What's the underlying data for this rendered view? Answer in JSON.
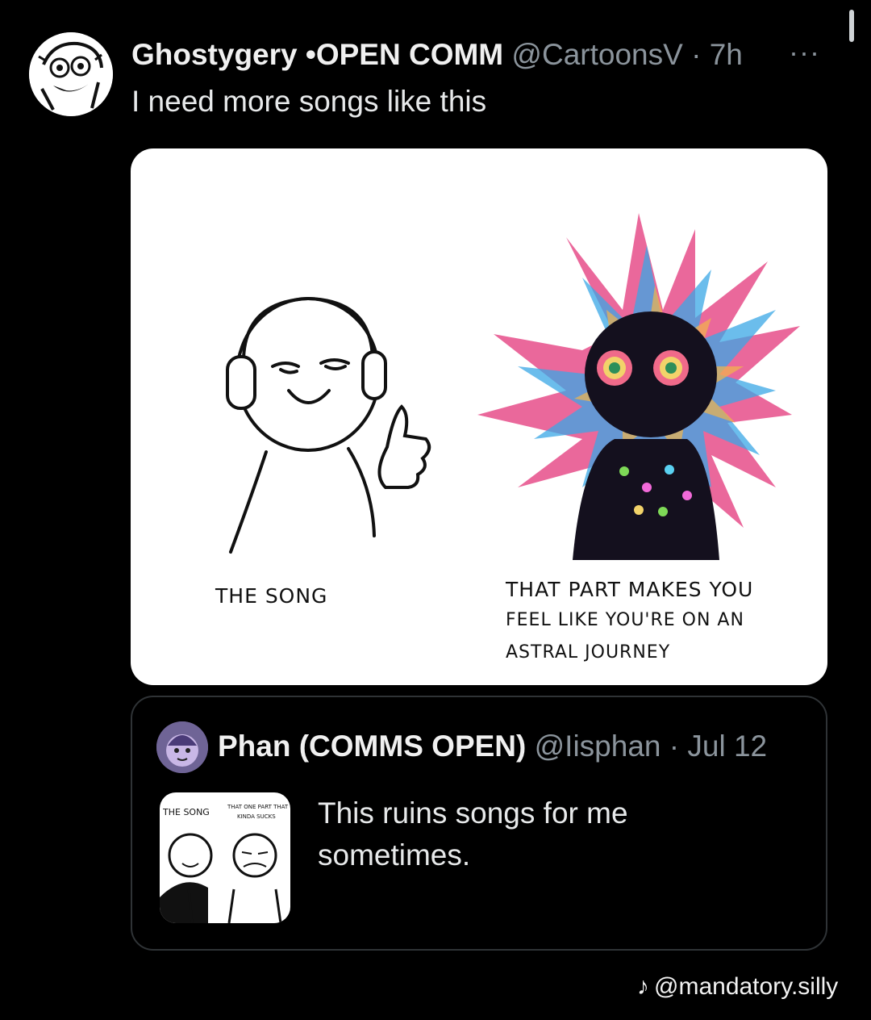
{
  "tweet": {
    "display_name": "Ghostygery •OPEN COMM",
    "handle": "@CartoonsV",
    "separator": " · ",
    "time": "7h",
    "more_glyph": "···",
    "text": "I need more songs like this"
  },
  "media": {
    "left_caption": "THE SONG",
    "right_caption_lines": [
      "THAT PART MAKES YOU",
      "FEEL LIKE YOU'RE ON AN",
      "ASTRAL JOURNEY"
    ]
  },
  "quote": {
    "display_name": "Phan (COMMS OPEN)",
    "handle": "@Iisphan",
    "separator": " · ",
    "date": "Jul 12",
    "text": "This ruins songs for me sometimes.",
    "thumb_left_caption": "THE SONG",
    "thumb_right_caption_lines": [
      "THAT ONE PART THAT",
      "KINDA SUCKS"
    ]
  },
  "watermark": {
    "icon": "tiktok-icon",
    "glyph": "♪",
    "text": "@mandatory.silly"
  },
  "colors": {
    "background": "#000000",
    "text_primary": "#e7e9ea",
    "text_secondary": "#8b949c",
    "border": "#2f3336"
  }
}
